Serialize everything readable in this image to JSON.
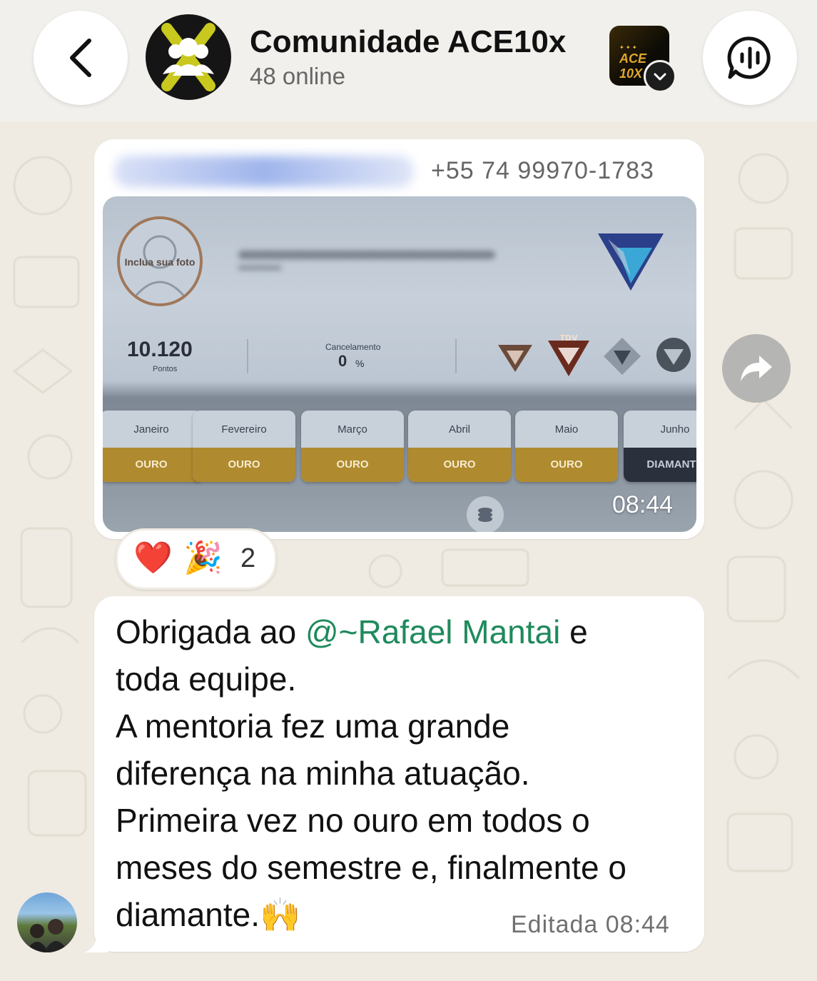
{
  "header": {
    "title": "Comunidade ACE10x",
    "subtitle": "48 online",
    "community_thumb_text": "ACE 10X"
  },
  "message_image": {
    "sender_phone": "+55 74 99970-1783",
    "photo": {
      "profile_caption": "Inclua sua foto",
      "points_value": "10.120",
      "points_label": "Pontos",
      "cancel_label": "Cancelamento",
      "cancel_value": "0",
      "cancel_unit": "%",
      "badge_label": "TDV",
      "months": [
        {
          "name": "Janeiro",
          "tier": "OURO"
        },
        {
          "name": "Fevereiro",
          "tier": "OURO"
        },
        {
          "name": "Março",
          "tier": "OURO"
        },
        {
          "name": "Abril",
          "tier": "OURO"
        },
        {
          "name": "Maio",
          "tier": "OURO"
        },
        {
          "name": "Junho",
          "tier": "DIAMANTE"
        }
      ]
    },
    "time": "08:44",
    "reactions": {
      "emojis": [
        "❤️",
        "🎉"
      ],
      "count": "2"
    }
  },
  "message_text": {
    "prefix": "Obrigada ao ",
    "mention": "@~Rafael Mantai",
    "after_mention": " e",
    "lines": [
      "toda equipe.",
      "A mentoria fez uma grande",
      "diferença na minha atuação.",
      "Primeira vez no ouro em todos o",
      "meses do semestre e, finalmente o"
    ],
    "last_line": "diamante.🙌",
    "edited_label": "Editada 08:44"
  }
}
